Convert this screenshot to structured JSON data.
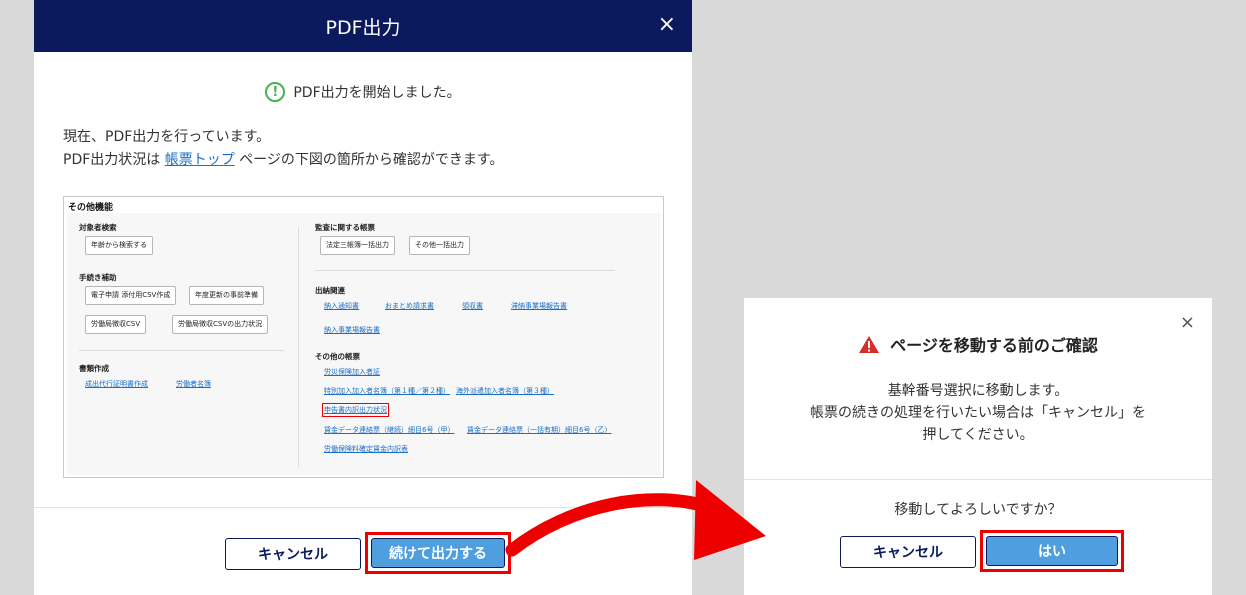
{
  "left_modal": {
    "title": "PDF出力",
    "close": "×",
    "status": "PDF出力を開始しました。",
    "desc_line1": "現在、PDF出力を行っています。",
    "desc_line2_pre": "PDF出力状況は ",
    "desc_link": "帳票トップ",
    "desc_line2_post": " ページの下図の箇所から確認ができます。",
    "cancel_label": "キャンセル",
    "continue_label": "続けて出力する"
  },
  "preview": {
    "title": "その他機能",
    "left": {
      "search_heading": "対象者検索",
      "search_button": "年齢から検索する",
      "proc_heading": "手続き補助",
      "proc_buttons": [
        "電子申請 添付用CSV作成",
        "年度更新の事前準備",
        "労働局徴収CSV",
        "労働局徴収CSVの出力状況"
      ],
      "docs_heading": "書類作成",
      "docs_links": [
        "成出代行証明書作成",
        "労働者名簿"
      ]
    },
    "right": {
      "audit_heading": "監査に関する帳票",
      "audit_buttons": [
        "法定三帳簿一括出力",
        "その他一括出力"
      ],
      "pay_heading": "出納関連",
      "pay_links": [
        "納入通知書",
        "おまとめ請求書",
        "領収書",
        "滞納事業場報告書",
        "納入事業場報告書"
      ],
      "other_heading": "その他の帳票",
      "other_links": [
        "労災保険加入者証",
        "特別加入加入者名簿（第１種／第２種）",
        "海外派遣加入者名簿（第３種）",
        "申告書内訳出力状況",
        "賃金データ連絡票（継続）細目6号（甲）",
        "賃金データ連絡票（一括有期）細目6号（乙）",
        "労働保険料確定賃金内訳表"
      ]
    }
  },
  "right_modal": {
    "close": "×",
    "title": "ページを移動する前のご確認",
    "body_line1": "基幹番号選択に移動します。",
    "body_line2": "帳票の続きの処理を行いたい場合は「キャンセル」を",
    "body_line3": "押してください。",
    "question": "移動してよろしいですか？",
    "cancel_label": "キャンセル",
    "yes_label": "はい"
  },
  "colors": {
    "header": "#0b1a5c",
    "primary": "#4e9ee0",
    "highlight": "#e00000",
    "success": "#4caf50",
    "warning": "#d32f2f"
  },
  "icons": {
    "status": "check-circle-icon",
    "warning": "warning-triangle-icon",
    "close": "close-icon"
  }
}
